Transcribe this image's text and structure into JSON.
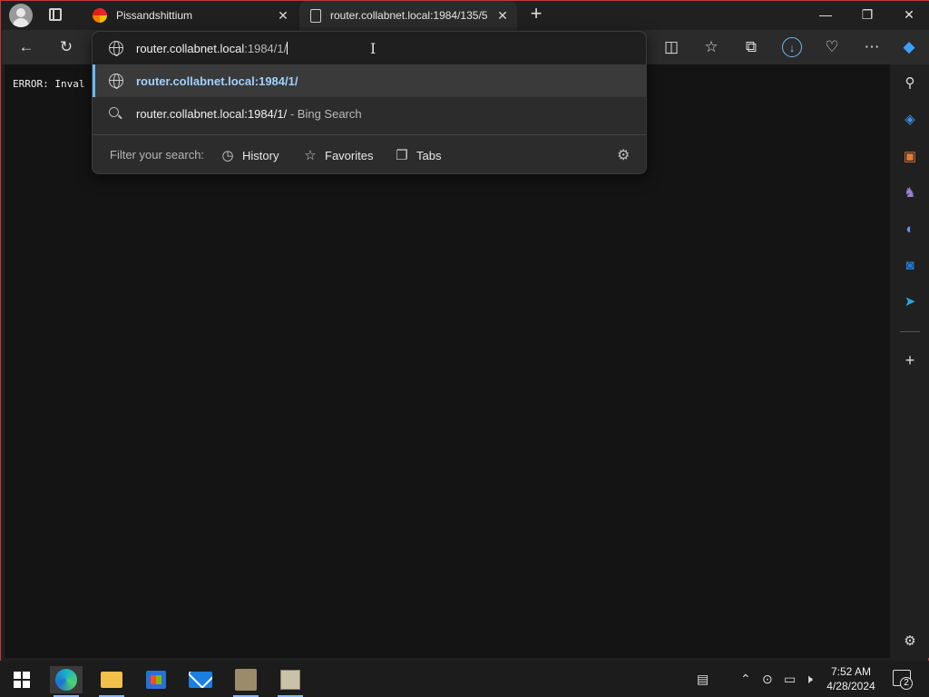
{
  "tabs": [
    {
      "label": "Pissandshittium",
      "icon": "rainbow-logo-icon"
    },
    {
      "label": "router.collabnet.local:1984/135/5",
      "icon": "page-icon"
    }
  ],
  "window": {
    "minimize": "—",
    "restore": "❐",
    "close": "✕"
  },
  "omnibox": {
    "typed": "router.collabnet.local",
    "typed_rest": ":1984/1/"
  },
  "suggestions": [
    {
      "text": "router.collabnet.local:1984/1/",
      "suffix": "",
      "icon": "globe-icon"
    },
    {
      "text": "router.collabnet.local:1984/1/",
      "suffix": " - Bing Search",
      "icon": "search-icon"
    }
  ],
  "filter": {
    "label": "Filter your search:",
    "chips": [
      "History",
      "Favorites",
      "Tabs"
    ]
  },
  "page": {
    "error_text": "ERROR: Inval"
  },
  "taskbar": {
    "time": "7:52 AM",
    "date": "4/28/2024",
    "notifications": "2"
  }
}
